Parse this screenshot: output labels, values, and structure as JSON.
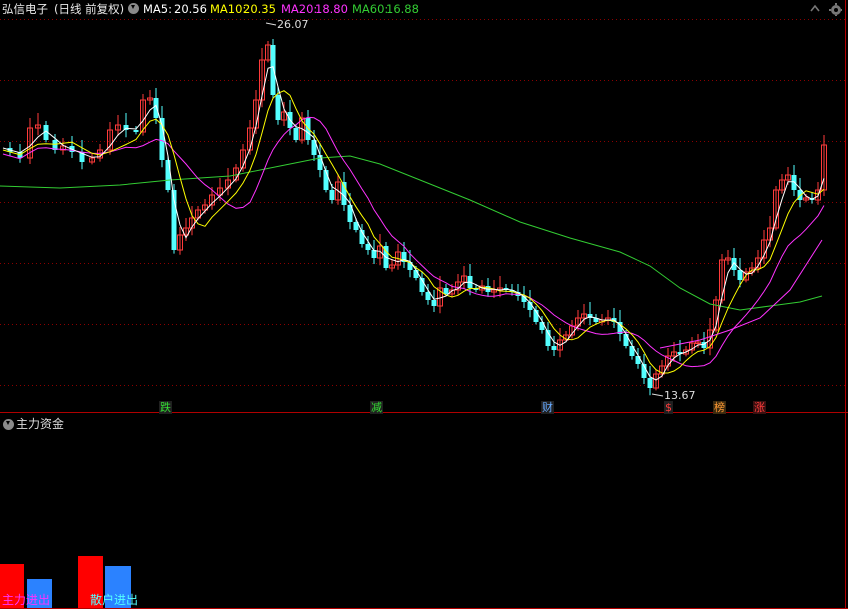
{
  "header": {
    "stock_name": "弘信电子",
    "period_label": "(日线 前复权)",
    "ma5_label": "MA5:",
    "ma5_value": "20.56",
    "ma10_label": "MA10:",
    "ma10_value": "20.35",
    "ma20_label": "MA20:",
    "ma20_value": "18.80",
    "ma60_label": "MA60:",
    "ma60_value": "16.88"
  },
  "colors": {
    "up": "#ff3b3b",
    "down": "#54ffff",
    "ma5": "#ffffff",
    "ma10": "#ffff00",
    "ma20": "#ff33ff",
    "ma60": "#33cc33",
    "grid": "#8b0000",
    "divider": "#b00000"
  },
  "price_chart": {
    "high_label": "26.07",
    "low_label": "13.67",
    "markers": [
      {
        "text": "跌",
        "color": "#33dd33",
        "bg": "#202020"
      },
      {
        "text": "减",
        "color": "#33dd33",
        "bg": "#202020"
      },
      {
        "text": "财",
        "color": "#66aaff",
        "bg": "#202020"
      },
      {
        "text": "$",
        "color": "#ff3b3b",
        "bg": "#202020"
      },
      {
        "text": "榜",
        "color": "#ff9933",
        "bg": "#3a2a10"
      },
      {
        "text": "涨",
        "color": "#ff3b3b",
        "bg": "#3a1010"
      }
    ]
  },
  "sub_panel": {
    "title": "主力资金",
    "legend": [
      {
        "text": "主力进出",
        "color": "#ff33ff"
      },
      {
        "text": "散户进出",
        "color": "#54ffff"
      }
    ]
  },
  "icons": {
    "collapse": "chevron-down-icon",
    "settings": "gear-icon",
    "up_arrow": "up-arrow-icon",
    "down_arrow": "down-arrow-icon"
  }
}
